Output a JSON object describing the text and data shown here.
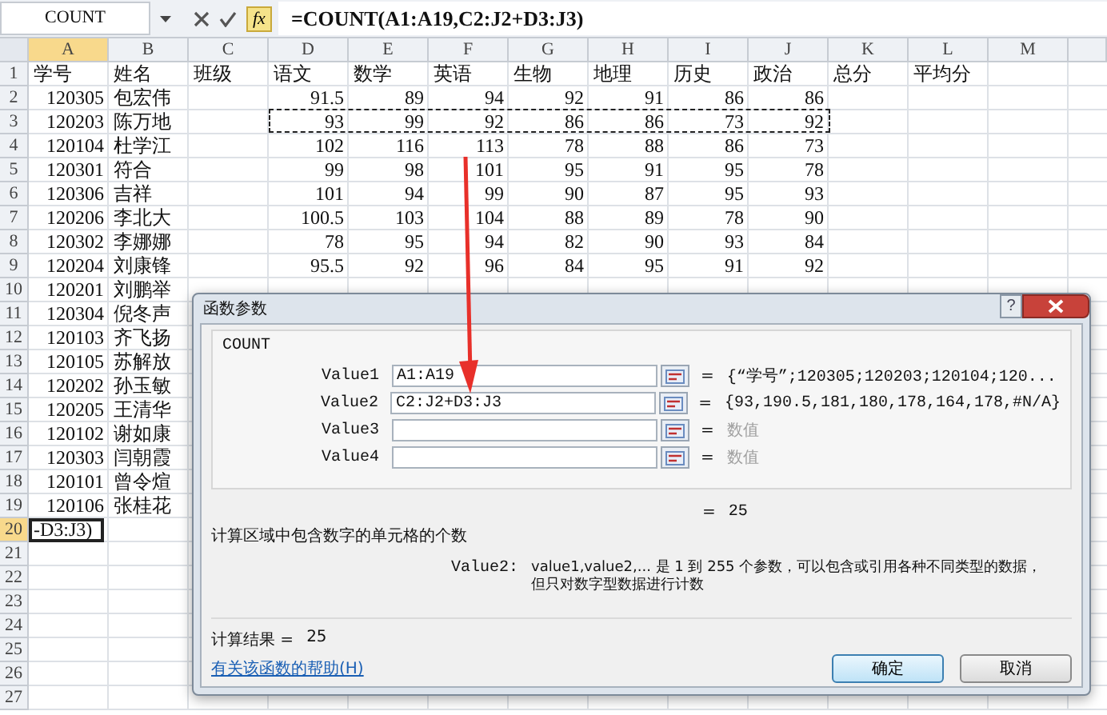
{
  "name_box": {
    "value": "COUNT"
  },
  "formula_bar": {
    "function_button": "fx",
    "formula": "=COUNT(A1:A19,C2:J2+D3:J3)"
  },
  "columns": [
    {
      "label": "A",
      "active": true
    },
    {
      "label": "B",
      "active": false
    },
    {
      "label": "C",
      "active": false
    },
    {
      "label": "D",
      "active": false
    },
    {
      "label": "E",
      "active": false
    },
    {
      "label": "F",
      "active": false
    },
    {
      "label": "G",
      "active": false
    },
    {
      "label": "H",
      "active": false
    },
    {
      "label": "I",
      "active": false
    },
    {
      "label": "J",
      "active": false
    },
    {
      "label": "K",
      "active": false
    },
    {
      "label": "L",
      "active": false
    },
    {
      "label": "M",
      "active": false
    }
  ],
  "rows": [
    {
      "number": "1",
      "kind": "header",
      "active": false,
      "marquee": false,
      "cells": [
        "学号",
        "姓名",
        "班级",
        "语文",
        "数学",
        "英语",
        "生物",
        "地理",
        "历史",
        "政治",
        "总分",
        "平均分"
      ]
    },
    {
      "number": "2",
      "kind": "data",
      "active": false,
      "marquee": false,
      "cells": [
        "120305",
        "包宏伟",
        null,
        "91.5",
        "89",
        "94",
        "92",
        "91",
        "86",
        "86"
      ]
    },
    {
      "number": "3",
      "kind": "data",
      "active": false,
      "marquee": true,
      "cells": [
        "120203",
        "陈万地",
        null,
        "93",
        "99",
        "92",
        "86",
        "86",
        "73",
        "92"
      ]
    },
    {
      "number": "4",
      "kind": "data",
      "active": false,
      "marquee": false,
      "cells": [
        "120104",
        "杜学江",
        null,
        "102",
        "116",
        "113",
        "78",
        "88",
        "86",
        "73"
      ]
    },
    {
      "number": "5",
      "kind": "data",
      "active": false,
      "marquee": false,
      "cells": [
        "120301",
        "符合",
        null,
        "99",
        "98",
        "101",
        "95",
        "91",
        "95",
        "78"
      ]
    },
    {
      "number": "6",
      "kind": "data",
      "active": false,
      "marquee": false,
      "cells": [
        "120306",
        "吉祥",
        null,
        "101",
        "94",
        "99",
        "90",
        "87",
        "95",
        "93"
      ]
    },
    {
      "number": "7",
      "kind": "data",
      "active": false,
      "marquee": false,
      "cells": [
        "120206",
        "李北大",
        null,
        "100.5",
        "103",
        "104",
        "88",
        "89",
        "78",
        "90"
      ]
    },
    {
      "number": "8",
      "kind": "data",
      "active": false,
      "marquee": false,
      "cells": [
        "120302",
        "李娜娜",
        null,
        "78",
        "95",
        "94",
        "82",
        "90",
        "93",
        "84"
      ]
    },
    {
      "number": "9",
      "kind": "data",
      "active": false,
      "marquee": false,
      "cells": [
        "120204",
        "刘康锋",
        null,
        "95.5",
        "92",
        "96",
        "84",
        "95",
        "91",
        "92"
      ]
    },
    {
      "number": "10",
      "kind": "data",
      "active": false,
      "marquee": false,
      "cells": [
        "120201",
        "刘鹏举"
      ]
    },
    {
      "number": "11",
      "kind": "data",
      "active": false,
      "marquee": false,
      "cells": [
        "120304",
        "倪冬声"
      ]
    },
    {
      "number": "12",
      "kind": "data",
      "active": false,
      "marquee": false,
      "cells": [
        "120103",
        "齐飞扬"
      ]
    },
    {
      "number": "13",
      "kind": "data",
      "active": false,
      "marquee": false,
      "cells": [
        "120105",
        "苏解放"
      ]
    },
    {
      "number": "14",
      "kind": "data",
      "active": false,
      "marquee": false,
      "cells": [
        "120202",
        "孙玉敏"
      ]
    },
    {
      "number": "15",
      "kind": "data",
      "active": false,
      "marquee": false,
      "cells": [
        "120205",
        "王清华"
      ]
    },
    {
      "number": "16",
      "kind": "data",
      "active": false,
      "marquee": false,
      "cells": [
        "120102",
        "谢如康"
      ]
    },
    {
      "number": "17",
      "kind": "data",
      "active": false,
      "marquee": false,
      "cells": [
        "120303",
        "闫朝霞"
      ]
    },
    {
      "number": "18",
      "kind": "data",
      "active": false,
      "marquee": false,
      "cells": [
        "120101",
        "曾令煊"
      ]
    },
    {
      "number": "19",
      "kind": "data",
      "active": false,
      "marquee": false,
      "cells": [
        "120106",
        "张桂花"
      ]
    },
    {
      "number": "20",
      "kind": "editing",
      "active": true,
      "marquee": false,
      "cells": [
        "-D3:J3)"
      ]
    },
    {
      "number": "21",
      "kind": "data",
      "active": false,
      "marquee": false,
      "cells": []
    },
    {
      "number": "22",
      "kind": "data",
      "active": false,
      "marquee": false,
      "cells": []
    },
    {
      "number": "23",
      "kind": "data",
      "active": false,
      "marquee": false,
      "cells": []
    },
    {
      "number": "24",
      "kind": "data",
      "active": false,
      "marquee": false,
      "cells": []
    },
    {
      "number": "25",
      "kind": "data",
      "active": false,
      "marquee": false,
      "cells": []
    },
    {
      "number": "26",
      "kind": "data",
      "active": false,
      "marquee": false,
      "cells": []
    },
    {
      "number": "27",
      "kind": "data",
      "active": false,
      "marquee": false,
      "cells": []
    }
  ],
  "dialog": {
    "title": "函数参数",
    "help": "?",
    "function_name": "COUNT",
    "args": [
      {
        "label": "Value1",
        "value": "A1:A19",
        "sign": "=",
        "result": "{“学号”;120305;120203;120104;120...",
        "hint": false
      },
      {
        "label": "Value2",
        "value": "C2:J2+D3:J3",
        "sign": "=",
        "result": "{93,190.5,181,180,178,164,178,#N/A}",
        "hint": false
      },
      {
        "label": "Value3",
        "sign": "=",
        "result": "数值",
        "hint": true
      },
      {
        "label": "Value4",
        "sign": "=",
        "result": "数值",
        "hint": true
      }
    ],
    "total": {
      "sign": "=",
      "value": "25"
    },
    "description": "计算区域中包含数字的单元格的个数",
    "arg_help": {
      "name": "Value2:",
      "lines": [
        "value1,value2,...  是 1 到 255 个参数，可以包含或引用各种不同类型的数据，",
        "但只对数字型数据进行计数"
      ]
    },
    "formula_result": {
      "label": "计算结果 =",
      "value": "25"
    },
    "help_link": "有关该函数的帮助(H)",
    "buttons": [
      {
        "label": "确定",
        "kind": "default"
      },
      {
        "label": "取消",
        "kind": "normal"
      }
    ]
  }
}
